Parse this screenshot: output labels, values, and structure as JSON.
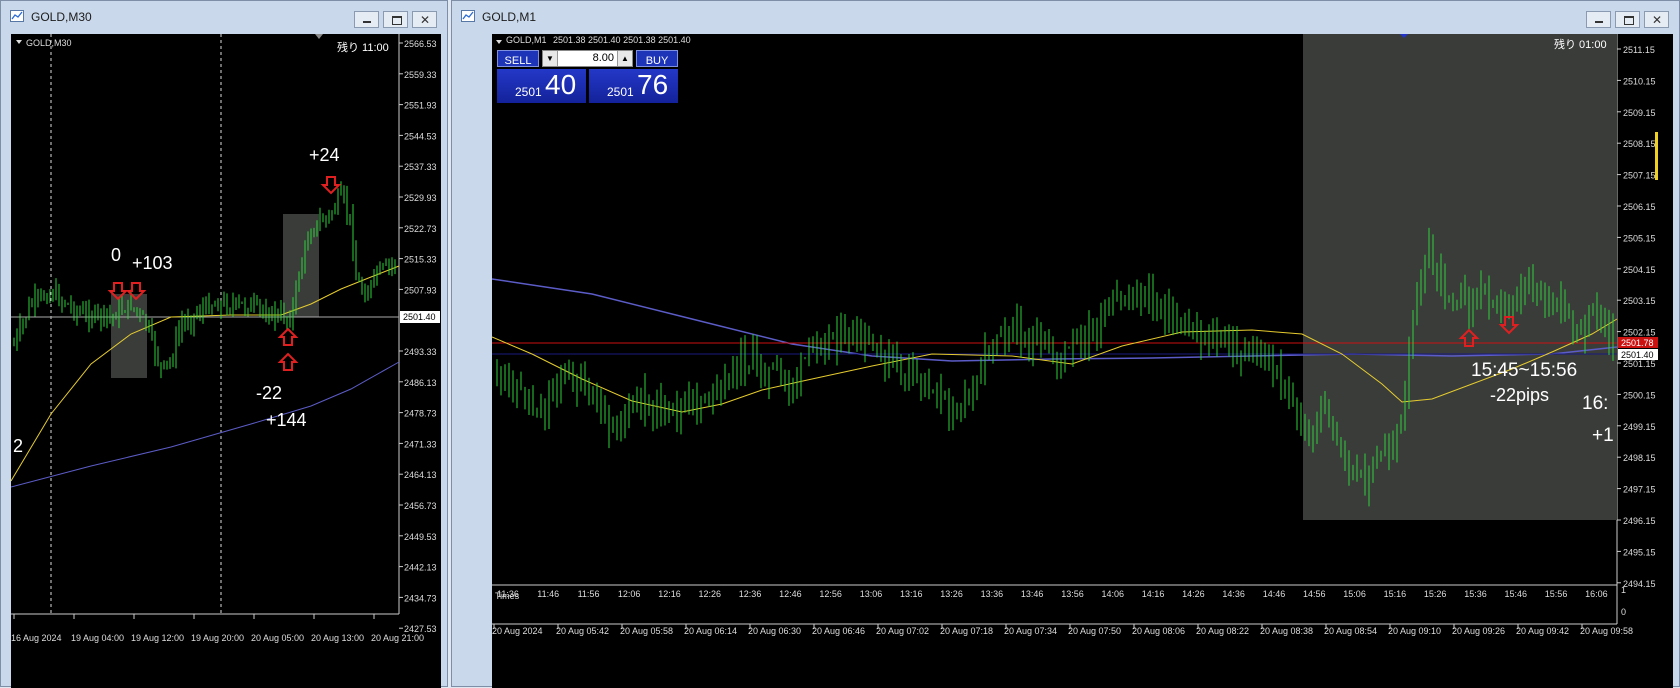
{
  "left_window": {
    "title": "GOLD,M30",
    "symbol_label": "GOLD,M30",
    "remaining": "残り 11:00",
    "price_labels": [
      "2566.53",
      "2559.33",
      "2551.93",
      "2544.53",
      "2537.33",
      "2529.93",
      "2522.73",
      "2515.33",
      "2507.93",
      "2493.33",
      "2486.13",
      "2478.73",
      "2471.33",
      "2464.13",
      "2456.73",
      "2449.53",
      "2442.13",
      "2434.73",
      "2427.53"
    ],
    "current_price": "2501.40",
    "time_labels": [
      "16 Aug 2024",
      "19 Aug 04:00",
      "19 Aug 12:00",
      "19 Aug 20:00",
      "20 Aug 05:00",
      "20 Aug 13:00",
      "20 Aug 21:00"
    ],
    "annotations": [
      "0",
      "+103",
      "+24",
      "-22",
      "+144",
      "2"
    ]
  },
  "right_window": {
    "title": "GOLD,M1",
    "symbol_label": "GOLD,M1",
    "ohlc": "2501.38 2501.40 2501.38 2501.40",
    "remaining": "残り 01:00",
    "price_labels": [
      "2511.15",
      "2510.15",
      "2509.15",
      "2508.15",
      "2507.15",
      "2506.15",
      "2505.15",
      "2504.15",
      "2503.15",
      "2502.15",
      "2501.15",
      "2500.15",
      "2499.15",
      "2498.15",
      "2497.15",
      "2496.15",
      "2495.15",
      "2494.15"
    ],
    "current_price": "2501.40",
    "red_line_price": "2501.78",
    "time_labels": [
      "20 Aug 2024",
      "20 Aug 05:42",
      "20 Aug 05:58",
      "20 Aug 06:14",
      "20 Aug 06:30",
      "20 Aug 06:46",
      "20 Aug 07:02",
      "20 Aug 07:18",
      "20 Aug 07:34",
      "20 Aug 07:50",
      "20 Aug 08:06",
      "20 Aug 08:22",
      "20 Aug 08:38",
      "20 Aug 08:54",
      "20 Aug 09:10",
      "20 Aug 09:26",
      "20 Aug 09:42",
      "20 Aug 09:58"
    ],
    "subwindow_times": [
      "11:36",
      "11:46",
      "11:56",
      "12:06",
      "12:16",
      "12:26",
      "12:36",
      "12:46",
      "12:56",
      "13:06",
      "13:16",
      "13:26",
      "13:36",
      "13:46",
      "13:56",
      "14:06",
      "14:16",
      "14:26",
      "14:36",
      "14:46",
      "14:56",
      "15:06",
      "15:16",
      "15:26",
      "15:36",
      "15:46",
      "15:56",
      "16:06"
    ],
    "subwindow_label": "Times",
    "subwindow_scale": [
      "1",
      "0"
    ],
    "annotations": {
      "range": "15:45~15:56",
      "pips": "-22pips",
      "cut_time": "16:",
      "cut_pips": "+1"
    }
  },
  "trade_panel": {
    "sell_label": "SELL",
    "buy_label": "BUY",
    "lot": "8.00",
    "sell_small": "2501",
    "sell_big": "40",
    "buy_small": "2501",
    "buy_big": "76"
  },
  "colors": {
    "candle": "#2cd13a",
    "ma_fast": "#e6cc2e",
    "ma_slow": "#5c5cc8",
    "bid_line": "#cc1111",
    "highlight": "#3a3c3a",
    "annotation_arrow": "#e02020"
  }
}
